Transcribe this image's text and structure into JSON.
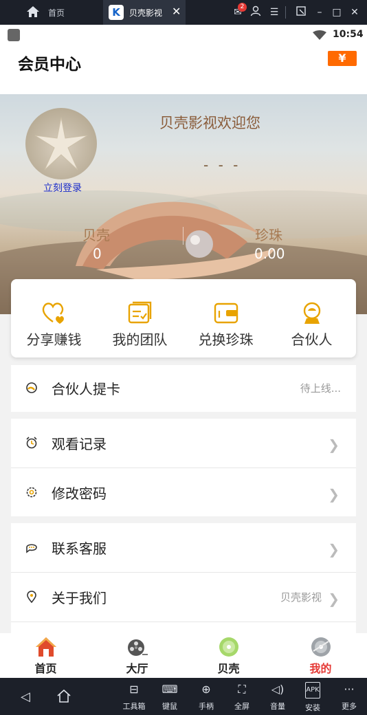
{
  "emulator": {
    "home_tab": "首页",
    "app_tab": "贝壳影视",
    "mail_badge": "2",
    "toolbar": [
      {
        "label": "工具箱",
        "icon": "toolbox-icon"
      },
      {
        "label": "键鼠",
        "icon": "keyboard-icon"
      },
      {
        "label": "手柄",
        "icon": "gamepad-icon"
      },
      {
        "label": "全屏",
        "icon": "fullscreen-icon"
      },
      {
        "label": "音量",
        "icon": "volume-icon"
      },
      {
        "label": "安装",
        "icon": "apk-install-icon"
      },
      {
        "label": "更多",
        "icon": "more-icon"
      }
    ]
  },
  "status_bar": {
    "time": "10:54"
  },
  "header": {
    "title": "会员中心",
    "currency_symbol": "¥"
  },
  "profile": {
    "welcome": "贝壳影视欢迎您",
    "username": "- - -",
    "login_link": "立刻登录",
    "shell_label": "贝壳",
    "shell_value": "0",
    "pearl_label": "珍珠",
    "pearl_value": "0.00"
  },
  "quick_actions": [
    {
      "label": "分享赚钱",
      "icon": "heart-share-icon"
    },
    {
      "label": "我的团队",
      "icon": "team-card-icon"
    },
    {
      "label": "兑换珍珠",
      "icon": "wallet-icon"
    },
    {
      "label": "合伙人",
      "icon": "partner-icon"
    }
  ],
  "menu": {
    "partner_card": {
      "label": "合伙人提卡",
      "note": "待上线..."
    },
    "history": {
      "label": "观看记录"
    },
    "password": {
      "label": "修改密码"
    },
    "service": {
      "label": "联系客服"
    },
    "about": {
      "label": "关于我们",
      "note": "贝壳影视"
    }
  },
  "bottom_nav": [
    {
      "label": "首页",
      "icon": "home-icon"
    },
    {
      "label": "大厅",
      "icon": "film-reel-icon"
    },
    {
      "label": "贝壳",
      "icon": "disc-icon"
    },
    {
      "label": "我的",
      "icon": "profile-disc-icon",
      "active": true
    }
  ],
  "colors": {
    "accent": "#e8a300",
    "active_nav": "#e53935",
    "currency_btn": "#ff6a00"
  }
}
